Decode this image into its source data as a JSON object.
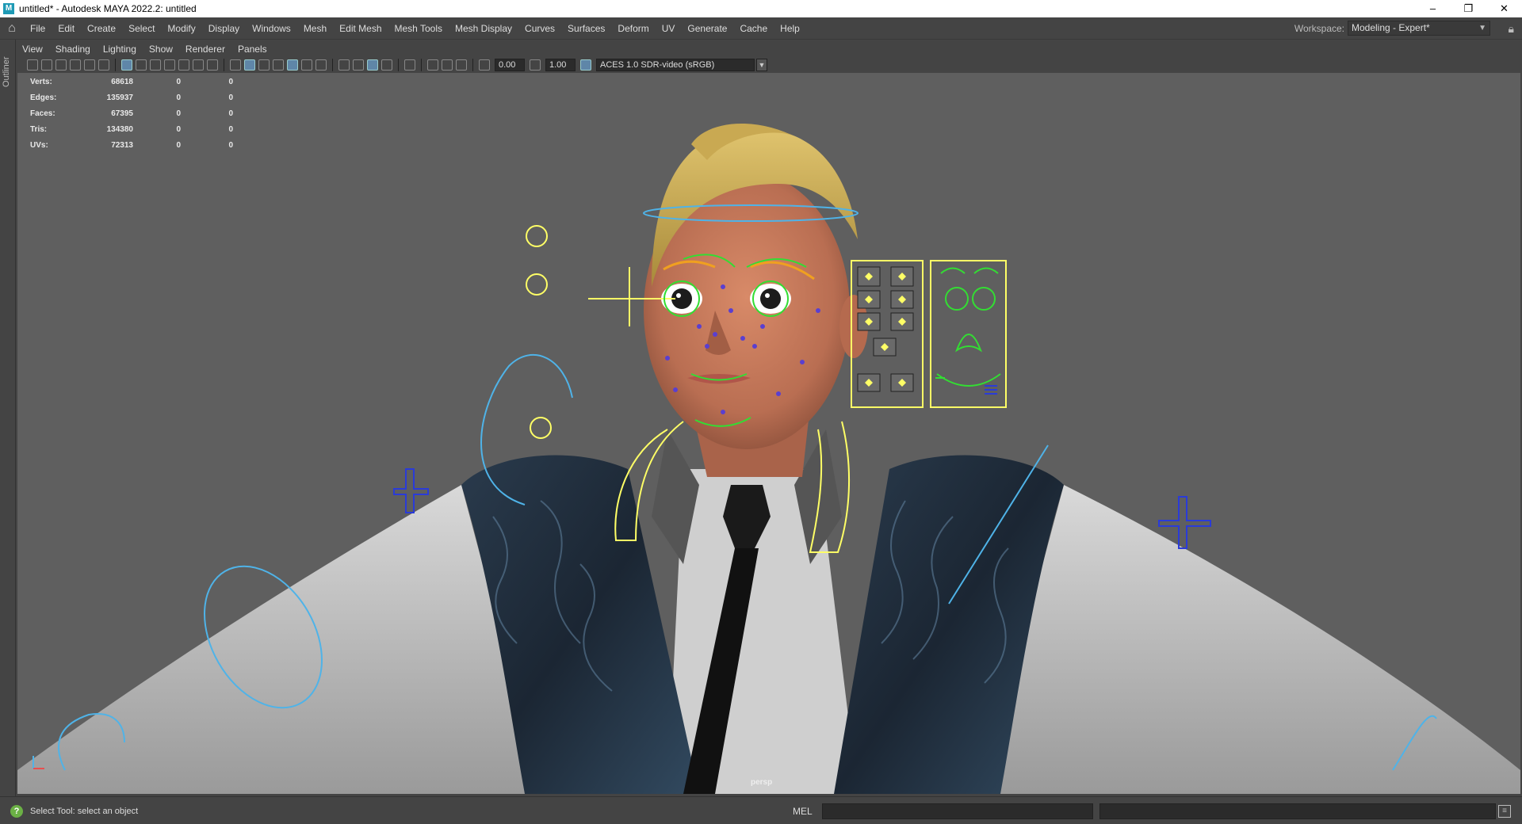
{
  "window": {
    "title": "untitled* - Autodesk MAYA 2022.2: untitled",
    "app_icon": "M",
    "controls": [
      "–",
      "❐",
      "✕"
    ]
  },
  "menubar": {
    "items": [
      "File",
      "Edit",
      "Create",
      "Select",
      "Modify",
      "Display",
      "Windows",
      "Mesh",
      "Edit Mesh",
      "Mesh Tools",
      "Mesh Display",
      "Curves",
      "Surfaces",
      "Deform",
      "UV",
      "Generate",
      "Cache",
      "Help"
    ],
    "workspace_label": "Workspace:",
    "workspace_value": "Modeling - Expert*"
  },
  "outliner_tab": "Outliner",
  "panel_menu": [
    "View",
    "Shading",
    "Lighting",
    "Show",
    "Renderer",
    "Panels"
  ],
  "toolbar": {
    "exposure": "0.00",
    "gamma": "1.00",
    "color_space": "ACES 1.0 SDR-video (sRGB)"
  },
  "hud": [
    {
      "label": "Verts:",
      "value": "68618",
      "a": "0",
      "b": "0"
    },
    {
      "label": "Edges:",
      "value": "135937",
      "a": "0",
      "b": "0"
    },
    {
      "label": "Faces:",
      "value": "67395",
      "a": "0",
      "b": "0"
    },
    {
      "label": "Tris:",
      "value": "134380",
      "a": "0",
      "b": "0"
    },
    {
      "label": "UVs:",
      "value": "72313",
      "a": "0",
      "b": "0"
    }
  ],
  "camera_label": "persp",
  "axis": {
    "x": "x",
    "y": "y"
  },
  "statusbar": {
    "help_text": "Select Tool: select an object",
    "script_lang": "MEL"
  },
  "colors": {
    "viewport_bg": "#5f5f5f",
    "ctrl_blue": "#4fb3e8",
    "ctrl_yellow": "#ffff66",
    "ctrl_green": "#33dd33",
    "ctrl_navy": "#2a3bd8"
  }
}
